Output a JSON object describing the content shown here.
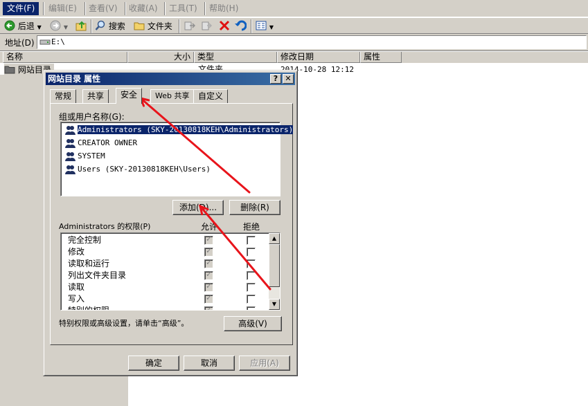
{
  "menu": [
    "文件(F)",
    "编辑(E)",
    "查看(V)",
    "收藏(A)",
    "工具(T)",
    "帮助(H)"
  ],
  "toolbar": {
    "back": "后退",
    "search": "搜索",
    "folders": "文件夹"
  },
  "address": {
    "label": "地址(D)",
    "value": "E:\\"
  },
  "list": {
    "columns": [
      "名称",
      "大小",
      "类型",
      "修改日期",
      "属性"
    ],
    "rows": [
      {
        "name": "网站目录",
        "type": "文件夹",
        "date": "2014-10-28 12:12"
      }
    ]
  },
  "dialog": {
    "title": "网站目录 属性",
    "tabs": [
      "常规",
      "共享",
      "安全",
      "Web 共享",
      "自定义"
    ],
    "active_tab": "安全",
    "group_label": "组或用户名称(G):",
    "users": [
      "Administrators (SKY-20130818KEH\\Administrators)",
      "CREATOR OWNER",
      "SYSTEM",
      "Users (SKY-20130818KEH\\Users)"
    ],
    "add_button": "添加(D)...",
    "remove_button": "删除(R)",
    "perm_label": "Administrators 的权限(P)",
    "allow_header": "允许",
    "deny_header": "拒绝",
    "permissions": [
      "完全控制",
      "修改",
      "读取和运行",
      "列出文件夹目录",
      "读取",
      "写入",
      "特别的权限"
    ],
    "advanced_text": "特别权限或高级设置，请单击“高级”。",
    "advanced_button": "高级(V)",
    "ok": "确定",
    "cancel": "取消",
    "apply": "应用(A)"
  },
  "annotation_color": "#e8141b"
}
